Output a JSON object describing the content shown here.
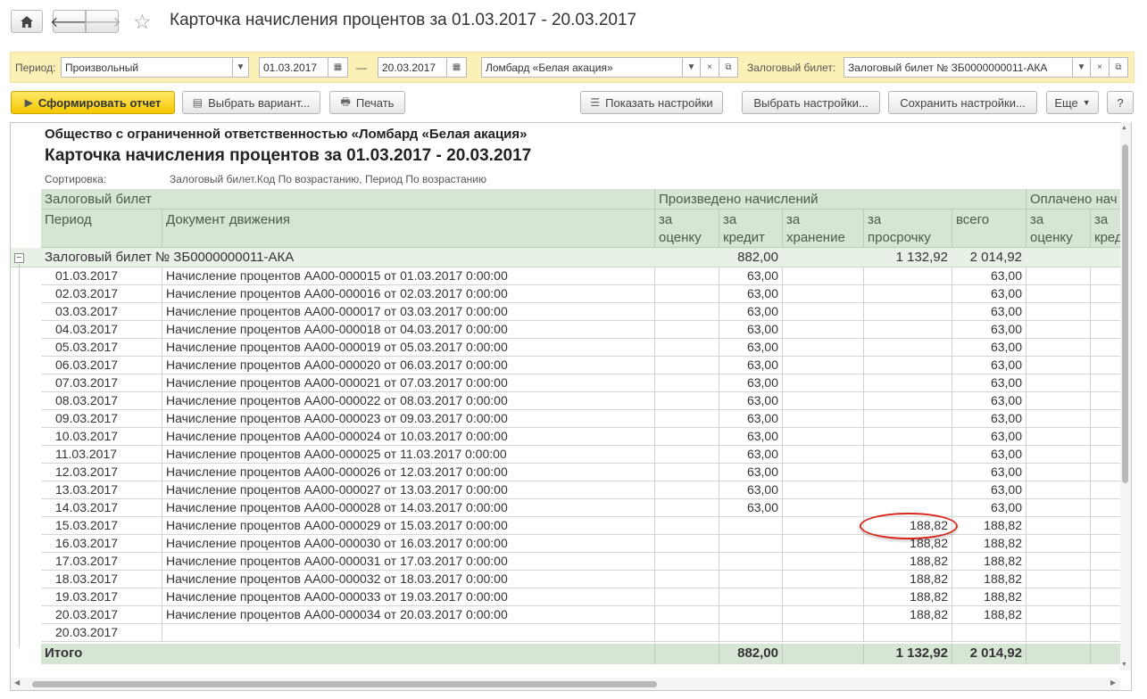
{
  "window": {
    "title": "Карточка начисления процентов за 01.03.2017 - 20.03.2017",
    "home_icon": "home-icon",
    "back_icon": "arrow-left-icon",
    "forward_icon": "arrow-right-icon",
    "favorite_icon": "star-icon"
  },
  "params": {
    "period_label": "Период:",
    "period_value": "Произвольный",
    "date_from": "01.03.2017",
    "date_sep": "—",
    "date_to": "20.03.2017",
    "org_value": "Ломбард «Белая акация»",
    "ticket_label": "Залоговый билет:",
    "ticket_value": "Залоговый билет № ЗБ0000000011-АКА"
  },
  "toolbar": {
    "generate": "Сформировать отчет",
    "choose_variant": "Выбрать вариант...",
    "print": "Печать",
    "show_settings": "Показать настройки",
    "choose_settings": "Выбрать настройки...",
    "save_settings": "Сохранить настройки...",
    "more": "Еще",
    "help": "?"
  },
  "report": {
    "org_title": "Общество с ограниченной ответственностью «Ломбард «Белая акация»",
    "title": "Карточка начисления процентов за 01.03.2017 - 20.03.2017",
    "sort_label": "Сортировка:",
    "sort_value": "Залоговый билет.Код По возрастанию, Период По возрастанию",
    "headers": {
      "ticket": "Залоговый билет",
      "accrued": "Произведено начислений",
      "paid": "Оплачено нач",
      "period": "Период",
      "document": "Документ движения",
      "valuation": "за\nоценку",
      "credit": "за\nкредит",
      "storage": "за\nхранение",
      "overdue": "за\nпросрочку",
      "total": "всего",
      "paid_valuation": "за\nоценку",
      "paid_credit": "за\nкред"
    },
    "group": {
      "label": "Залоговый билет № ЗБ0000000011-АКА",
      "credit": "882,00",
      "overdue": "1 132,92",
      "total": "2 014,92"
    },
    "rows": [
      {
        "period": "01.03.2017",
        "doc": "Начисление процентов АА00-000015 от 01.03.2017 0:00:00",
        "credit": "63,00",
        "overdue": "",
        "total": "63,00"
      },
      {
        "period": "02.03.2017",
        "doc": "Начисление процентов АА00-000016 от 02.03.2017 0:00:00",
        "credit": "63,00",
        "overdue": "",
        "total": "63,00"
      },
      {
        "period": "03.03.2017",
        "doc": "Начисление процентов АА00-000017 от 03.03.2017 0:00:00",
        "credit": "63,00",
        "overdue": "",
        "total": "63,00"
      },
      {
        "period": "04.03.2017",
        "doc": "Начисление процентов АА00-000018 от 04.03.2017 0:00:00",
        "credit": "63,00",
        "overdue": "",
        "total": "63,00"
      },
      {
        "period": "05.03.2017",
        "doc": "Начисление процентов АА00-000019 от 05.03.2017 0:00:00",
        "credit": "63,00",
        "overdue": "",
        "total": "63,00"
      },
      {
        "period": "06.03.2017",
        "doc": "Начисление процентов АА00-000020 от 06.03.2017 0:00:00",
        "credit": "63,00",
        "overdue": "",
        "total": "63,00"
      },
      {
        "period": "07.03.2017",
        "doc": "Начисление процентов АА00-000021 от 07.03.2017 0:00:00",
        "credit": "63,00",
        "overdue": "",
        "total": "63,00"
      },
      {
        "period": "08.03.2017",
        "doc": "Начисление процентов АА00-000022 от 08.03.2017 0:00:00",
        "credit": "63,00",
        "overdue": "",
        "total": "63,00"
      },
      {
        "period": "09.03.2017",
        "doc": "Начисление процентов АА00-000023 от 09.03.2017 0:00:00",
        "credit": "63,00",
        "overdue": "",
        "total": "63,00"
      },
      {
        "period": "10.03.2017",
        "doc": "Начисление процентов АА00-000024 от 10.03.2017 0:00:00",
        "credit": "63,00",
        "overdue": "",
        "total": "63,00"
      },
      {
        "period": "11.03.2017",
        "doc": "Начисление процентов АА00-000025 от 11.03.2017 0:00:00",
        "credit": "63,00",
        "overdue": "",
        "total": "63,00"
      },
      {
        "period": "12.03.2017",
        "doc": "Начисление процентов АА00-000026 от 12.03.2017 0:00:00",
        "credit": "63,00",
        "overdue": "",
        "total": "63,00"
      },
      {
        "period": "13.03.2017",
        "doc": "Начисление процентов АА00-000027 от 13.03.2017 0:00:00",
        "credit": "63,00",
        "overdue": "",
        "total": "63,00"
      },
      {
        "period": "14.03.2017",
        "doc": "Начисление процентов АА00-000028 от 14.03.2017 0:00:00",
        "credit": "63,00",
        "overdue": "",
        "total": "63,00"
      },
      {
        "period": "15.03.2017",
        "doc": "Начисление процентов АА00-000029 от 15.03.2017 0:00:00",
        "credit": "",
        "overdue": "188,82",
        "total": "188,82"
      },
      {
        "period": "16.03.2017",
        "doc": "Начисление процентов АА00-000030 от 16.03.2017 0:00:00",
        "credit": "",
        "overdue": "188,82",
        "total": "188,82"
      },
      {
        "period": "17.03.2017",
        "doc": "Начисление процентов АА00-000031 от 17.03.2017 0:00:00",
        "credit": "",
        "overdue": "188,82",
        "total": "188,82"
      },
      {
        "period": "18.03.2017",
        "doc": "Начисление процентов АА00-000032 от 18.03.2017 0:00:00",
        "credit": "",
        "overdue": "188,82",
        "total": "188,82"
      },
      {
        "period": "19.03.2017",
        "doc": "Начисление процентов АА00-000033 от 19.03.2017 0:00:00",
        "credit": "",
        "overdue": "188,82",
        "total": "188,82"
      },
      {
        "period": "20.03.2017",
        "doc": "Начисление процентов АА00-000034 от 20.03.2017 0:00:00",
        "credit": "",
        "overdue": "188,82",
        "total": "188,82"
      },
      {
        "period": "20.03.2017",
        "doc": "",
        "credit": "",
        "overdue": "",
        "total": ""
      }
    ],
    "totals": {
      "label": "Итого",
      "credit": "882,00",
      "overdue": "1 132,92",
      "total": "2 014,92"
    }
  },
  "colors": {
    "accent_yellow": "#f3c800",
    "params_bg": "#fbf0b6",
    "header_green": "#d6e5d4",
    "highlight_red": "#d9261c"
  }
}
